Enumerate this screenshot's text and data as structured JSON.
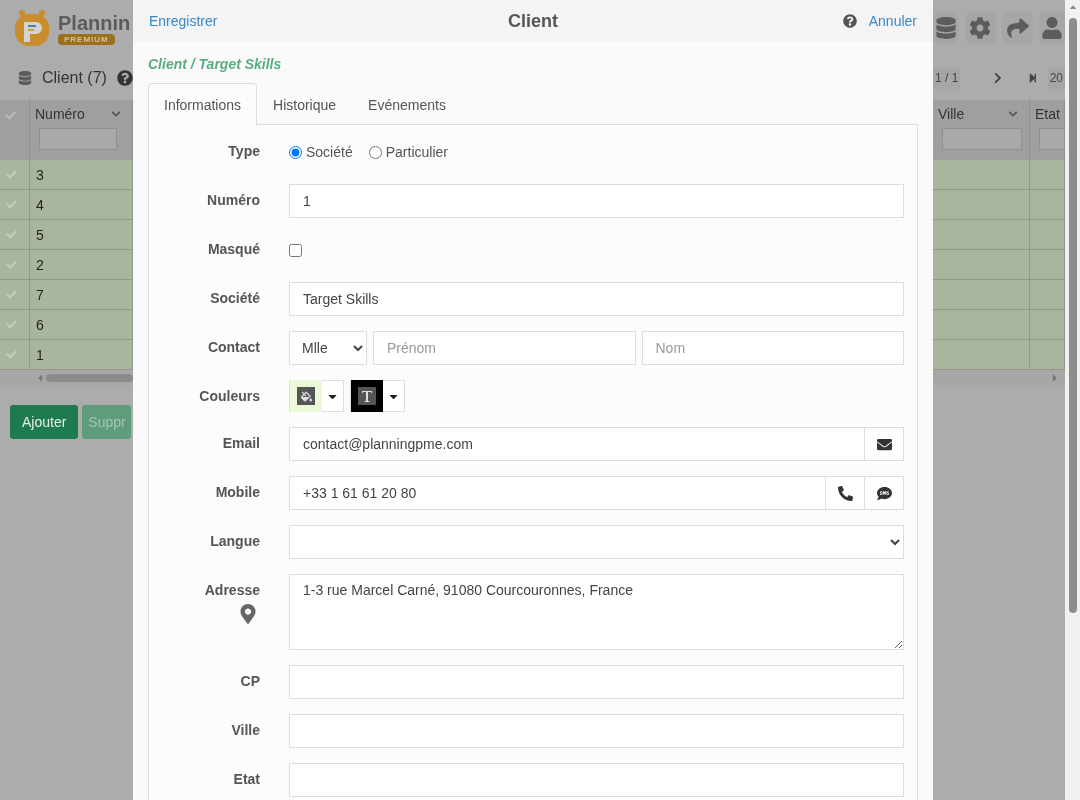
{
  "app": {
    "logo": {
      "name": "Plannin",
      "badge": "PREMIUM"
    },
    "toolbar": {
      "title": "Client (7)"
    },
    "pager": {
      "page": "1 / 1",
      "page_size": "20"
    },
    "table": {
      "columns": [
        {
          "label": "Numéro"
        },
        {
          "label": "Ville"
        },
        {
          "label": "Etat"
        }
      ],
      "rows": [
        {
          "numero": "3"
        },
        {
          "numero": "4"
        },
        {
          "numero": "5"
        },
        {
          "numero": "2"
        },
        {
          "numero": "7"
        },
        {
          "numero": "6"
        },
        {
          "numero": "1"
        }
      ]
    },
    "buttons": [
      "Ajouter",
      "Suppr"
    ]
  },
  "dialog": {
    "save": "Enregistrer",
    "title": "Client",
    "cancel": "Annuler",
    "breadcrumb": "Client / Target Skills",
    "tabs": [
      {
        "label": "Informations",
        "selected": true
      },
      {
        "label": "Historique",
        "selected": false
      },
      {
        "label": "Evénements",
        "selected": false
      }
    ],
    "form": [
      {
        "kind": "radio",
        "label": "Type",
        "options": [
          {
            "label": "Société",
            "selected": true
          },
          {
            "label": "Particulier",
            "selected": false
          }
        ]
      },
      {
        "kind": "text",
        "label": "Numéro",
        "value": "1"
      },
      {
        "kind": "checkbox",
        "label": "Masqué",
        "checked": false
      },
      {
        "kind": "text",
        "label": "Société",
        "value": "Target Skills"
      },
      {
        "kind": "contact",
        "label": "Contact",
        "civility": "Mlle",
        "first_name_placeholder": "Prénom",
        "last_name_placeholder": "Nom"
      },
      {
        "kind": "colors",
        "label": "Couleurs",
        "pickers": [
          {
            "kind": "fill",
            "color": "#eafad9"
          },
          {
            "kind": "text",
            "color": "#000000"
          }
        ]
      },
      {
        "kind": "email",
        "label": "Email",
        "value": "contact@planningpme.com"
      },
      {
        "kind": "phone",
        "label": "Mobile",
        "value": "+33 1 61 61 20 80"
      },
      {
        "kind": "select",
        "label": "Langue"
      },
      {
        "kind": "address",
        "label": "Adresse",
        "value": "1-3 rue Marcel Carné, 91080 Courcouronnes, France"
      },
      {
        "kind": "text",
        "label": "CP"
      },
      {
        "kind": "text",
        "label": "Ville"
      },
      {
        "kind": "text",
        "label": "Etat"
      }
    ]
  }
}
